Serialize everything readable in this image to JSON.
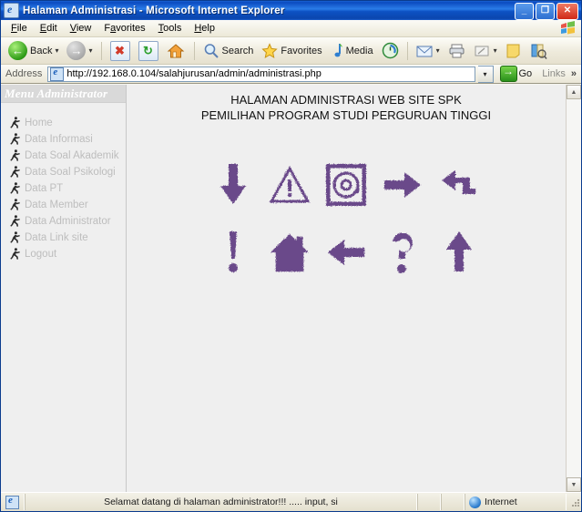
{
  "window": {
    "title": "Halaman Administrasi - Microsoft Internet Explorer",
    "minimize_label": "_",
    "restore_label": "❐",
    "close_label": "✕"
  },
  "menubar": {
    "items": [
      {
        "label": "File",
        "accel": "F"
      },
      {
        "label": "Edit",
        "accel": "E"
      },
      {
        "label": "View",
        "accel": "V"
      },
      {
        "label": "Favorites",
        "accel": "a"
      },
      {
        "label": "Tools",
        "accel": "T"
      },
      {
        "label": "Help",
        "accel": "H"
      }
    ]
  },
  "toolbar": {
    "back_label": "Back",
    "search_label": "Search",
    "favorites_label": "Favorites",
    "media_label": "Media",
    "dropdown_caret": "▾",
    "icons": {
      "back": "back-arrow-icon",
      "forward": "forward-arrow-icon",
      "stop": "stop-icon",
      "refresh": "refresh-icon",
      "home": "home-icon",
      "search": "magnifier-icon",
      "favorites": "star-icon",
      "media": "media-note-icon",
      "history": "history-icon",
      "mail": "mail-icon",
      "print": "printer-icon",
      "edit": "edit-page-icon",
      "notes": "notepad-icon",
      "messenger": "messenger-icon"
    }
  },
  "address": {
    "label": "Address",
    "url": "http://192.168.0.104/salahjurusan/admin/administrasi.php",
    "caret": "▾",
    "go_label": "Go",
    "links_label": "Links",
    "chevron": "»"
  },
  "sidebar": {
    "header": "Menu Administrator",
    "items": [
      {
        "label": "Home"
      },
      {
        "label": "Data Informasi"
      },
      {
        "label": "Data Soal Akademik"
      },
      {
        "label": "Data Soal Psikologi"
      },
      {
        "label": "Data PT"
      },
      {
        "label": "Data Member"
      },
      {
        "label": "Data Administrator"
      },
      {
        "label": "Data Link site"
      },
      {
        "label": "Logout"
      }
    ],
    "bullet_icon": "running-man-icon"
  },
  "content": {
    "heading_line1": "HALAMAN ADMINISTRASI WEB SITE SPK",
    "heading_line2": "PEMILIHAN PROGRAM STUDI PERGURUAN TINGGI",
    "icon_color": "#6b4a8a",
    "icon_rows": [
      [
        {
          "name": "down-arrow-icon"
        },
        {
          "name": "warning-triangle-icon"
        },
        {
          "name": "at-sign-icon"
        },
        {
          "name": "right-arrow-icon"
        },
        {
          "name": "reply-left-arrow-icon"
        }
      ],
      [
        {
          "name": "exclamation-mark-icon"
        },
        {
          "name": "house-icon"
        },
        {
          "name": "left-arrow-icon"
        },
        {
          "name": "question-mark-icon"
        },
        {
          "name": "up-arrow-icon"
        }
      ]
    ]
  },
  "scrollbar": {
    "up_arrow": "▲",
    "down_arrow": "▼"
  },
  "statusbar": {
    "message": "Selamat datang di halaman administrator!!!  ..... input, si",
    "zone": "Internet"
  }
}
